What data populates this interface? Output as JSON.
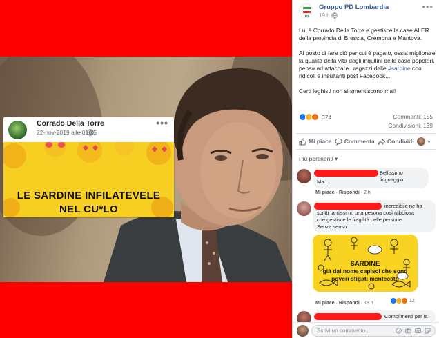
{
  "post_preview": {
    "author": "Corrado Della Torre",
    "date": "22-nov-2019 alle 01:25",
    "separator": "·",
    "more": "•••",
    "image_text_line1": "LE SARDINE INFILATEVELE",
    "image_text_line2": "NEL CU*LO"
  },
  "post": {
    "page_name": "Gruppo PD Lombardia",
    "time": "19 h ·",
    "more": "•••",
    "paragraph1": "Lui è Corrado Della Torre e gestisce le case ALER della provincia di Brescia, Cremona e Mantova.",
    "paragraph2_before": "Al posto di fare ciò per cui è pagato, ossia migliorare la qualità della vita degli inquilini delle case popolari, pensa ad attaccare i ragazzi delle ",
    "paragraph2_hashtag": "#sardine",
    "paragraph2_after": " con ridicoli e insultanti post Facebook...",
    "paragraph3": "Certi leghisti non si smentiscono mai!",
    "reaction_count": "374",
    "comments": "Commenti: 155",
    "shares": "Condivisioni: 139"
  },
  "actions": {
    "like": "Mi piace",
    "comment": "Commenta",
    "share": "Condividi"
  },
  "sort_label": "Più pertinenti ▾",
  "comments": [
    {
      "text_line1": "Bellissimo linguaggio!",
      "text_line2": "Ma....",
      "like": "Mi piace",
      "reply": "Rispondi",
      "time": "2 h",
      "sep": "·"
    },
    {
      "text_line1": "incredibile ne ha",
      "text_line2": "scritti tantissimi, una pesona così rabbiosa",
      "text_line3": "che gestisce le fragilità delle persone.",
      "text_line4": "Senza senso.",
      "image_line1": "SARDINE",
      "image_line2": "già dal nome capisci che sono",
      "image_line3": "poveri sfigati mentecatti",
      "like": "Mi piace",
      "reply": "Rispondi",
      "time": "18 h",
      "sep": "·",
      "reaction_count": "12"
    },
    {
      "text_line1": "Complimenti per la"
    }
  ],
  "composer": {
    "placeholder": "Scrivi un commento..."
  },
  "colors": {
    "background_red": "#ff0000",
    "facebook_link": "#385898",
    "redaction": "#ff1a1a",
    "like_blue": "#1877f2",
    "love_red": "#f33e58",
    "haha_yellow": "#f7b125"
  }
}
